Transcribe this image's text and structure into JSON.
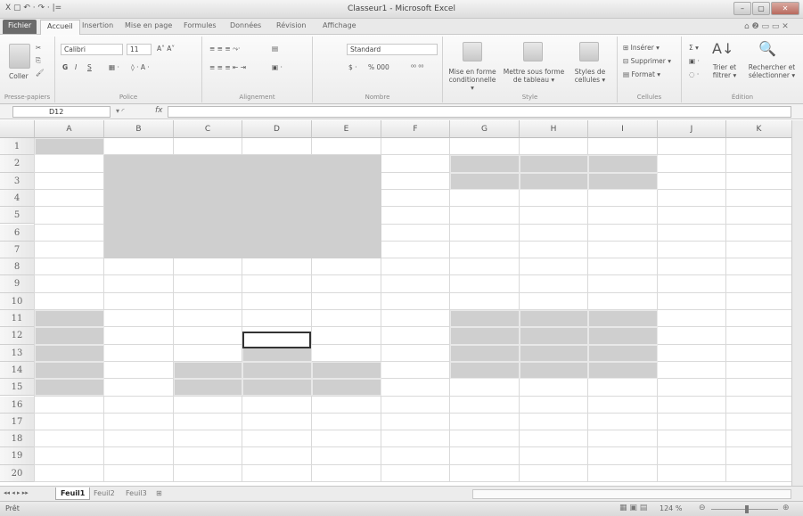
{
  "window": {
    "title": "Classeur1 - Microsoft Excel",
    "quick_access": "X ▢ ↶ · ↷ · |="
  },
  "ribbon_tabs": [
    "Fichier",
    "Accueil",
    "Insertion",
    "Mise en page",
    "Formules",
    "Données",
    "Révision",
    "Affichage"
  ],
  "ribbon": {
    "paste": "Coller",
    "font_name": "Calibri",
    "font_size": "11",
    "bold": "G",
    "italic": "I",
    "underline": "S",
    "number_format": "Standard",
    "percent": "% 000",
    "cond_format": "Mise en forme conditionnelle ▾",
    "table_format": "Mettre sous forme de tableau ▾",
    "cell_styles": "Styles de cellules ▾",
    "insert": "Insérer ▾",
    "delete": "Supprimer ▾",
    "format": "Format ▾",
    "sum": "Σ ▾",
    "sort": "Trier et filtrer ▾",
    "find": "Rechercher et sélectionner ▾",
    "groups": [
      "Presse-papiers",
      "Police",
      "Alignement",
      "Nombre",
      "Style",
      "Cellules",
      "Édition"
    ]
  },
  "formula_bar": {
    "name_box": "D12",
    "fx": "fx",
    "value": ""
  },
  "columns": [
    "A",
    "B",
    "C",
    "D",
    "E",
    "F",
    "G",
    "H",
    "I",
    "J",
    "K"
  ],
  "rows": [
    "1",
    "2",
    "3",
    "4",
    "5",
    "6",
    "7",
    "8",
    "9",
    "10",
    "11",
    "12",
    "13",
    "14",
    "15",
    "16",
    "17",
    "18",
    "19",
    "20"
  ],
  "sheets": [
    "Feuil1",
    "Feuil2",
    "Feuil3"
  ],
  "status": {
    "mode": "Prêt",
    "zoom": "124 %"
  }
}
